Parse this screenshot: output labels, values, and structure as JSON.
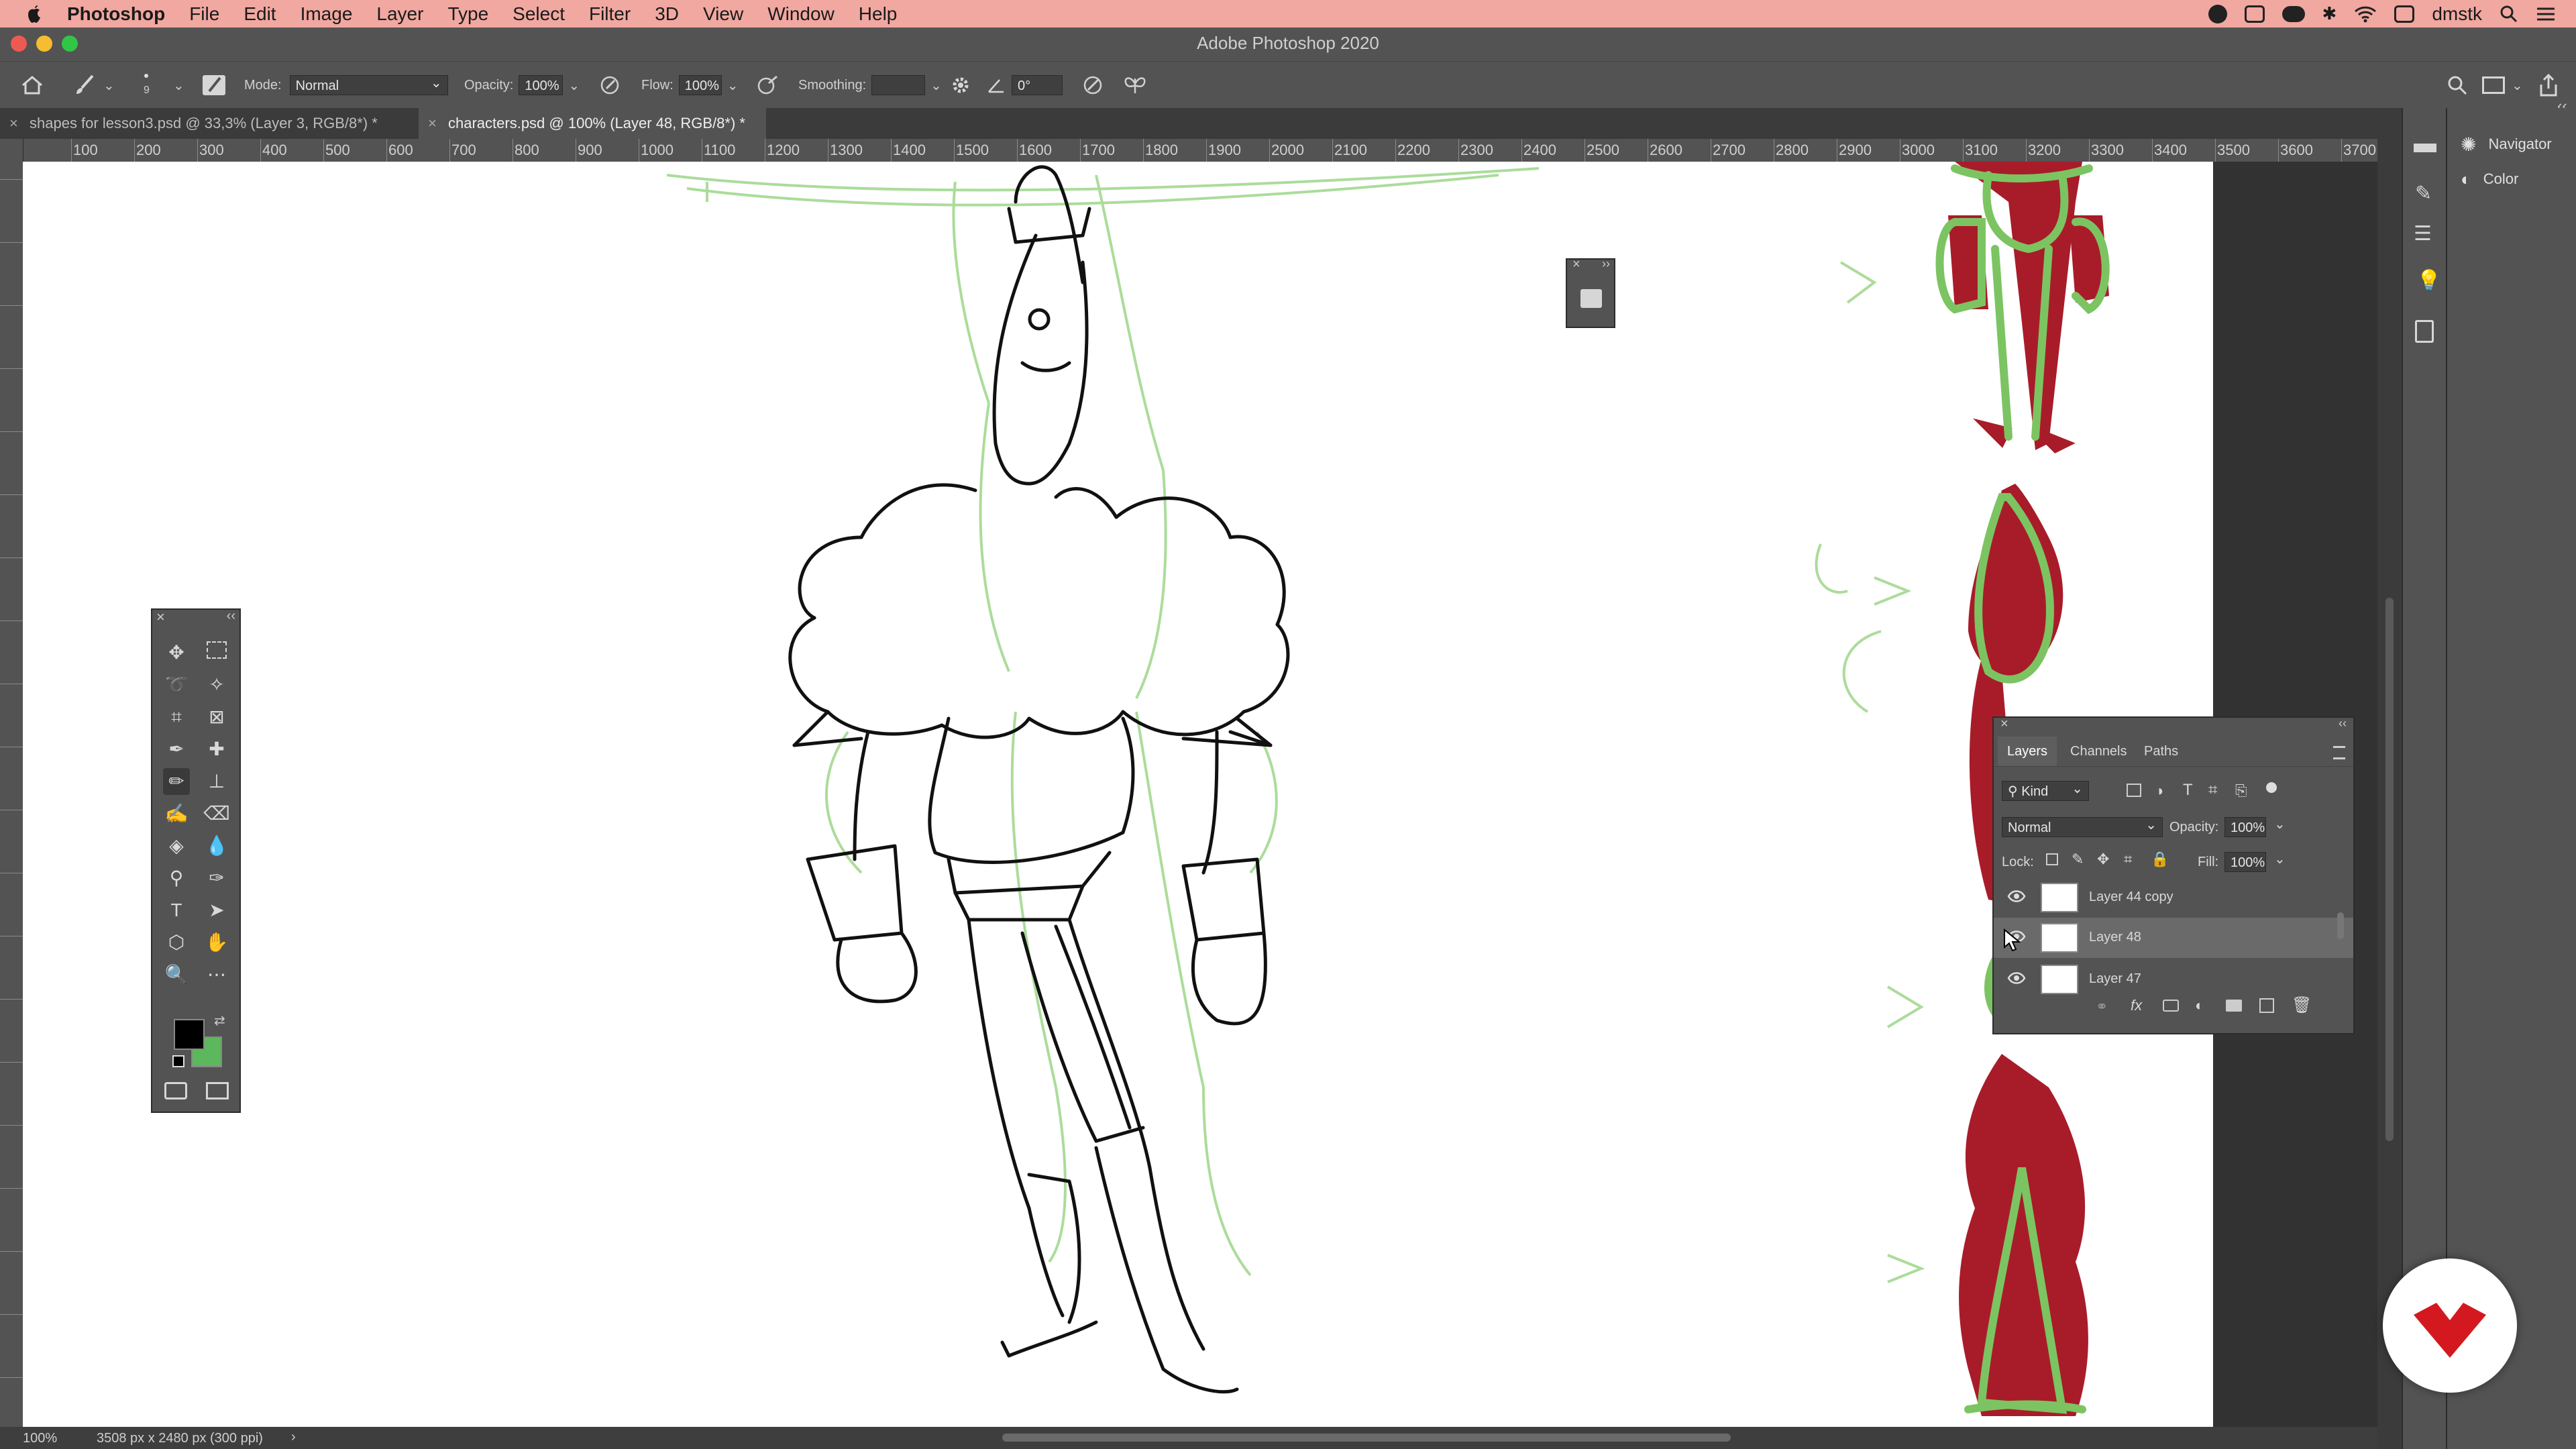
{
  "menubar": {
    "app_name": "Photoshop",
    "items": [
      "File",
      "Edit",
      "Image",
      "Layer",
      "Type",
      "Select",
      "Filter",
      "3D",
      "View",
      "Window",
      "Help"
    ],
    "user": "dmstk"
  },
  "window": {
    "title": "Adobe Photoshop 2020"
  },
  "options": {
    "brush_size": "9",
    "mode_label": "Mode:",
    "mode_value": "Normal",
    "opacity_label": "Opacity:",
    "opacity_value": "100%",
    "flow_label": "Flow:",
    "flow_value": "100%",
    "smoothing_label": "Smoothing:",
    "smoothing_value": "",
    "angle_value": "0°"
  },
  "tabs": [
    {
      "label": "shapes for lesson3.psd @ 33,3% (Layer 3, RGB/8*) *"
    },
    {
      "label": "characters.psd @ 100% (Layer 48, RGB/8*) *"
    }
  ],
  "ruler": {
    "h_ticks": [
      "100",
      "200",
      "300",
      "400",
      "500",
      "600",
      "700",
      "800",
      "900",
      "1000",
      "1100",
      "1200",
      "1300",
      "1400",
      "1500",
      "1600",
      "1700",
      "1800",
      "1900",
      "2000",
      "2100",
      "2200",
      "2300",
      "2400",
      "2500",
      "2600",
      "2700",
      "2800",
      "2900",
      "3000",
      "3100",
      "3200",
      "3300",
      "3400",
      "3500",
      "3600",
      "3700"
    ]
  },
  "dock": {
    "items": [
      {
        "label": "Navigator",
        "icon": "navigator-icon"
      },
      {
        "label": "Color",
        "icon": "color-icon"
      }
    ]
  },
  "layers_panel": {
    "tabs": [
      "Layers",
      "Channels",
      "Paths"
    ],
    "filter_kind": "Kind",
    "blend_mode": "Normal",
    "opacity_label": "Opacity:",
    "opacity_value": "100%",
    "lock_label": "Lock:",
    "fill_label": "Fill:",
    "fill_value": "100%",
    "layers": [
      {
        "name": "Layer 44 copy",
        "selected": false
      },
      {
        "name": "Layer 48",
        "selected": true
      },
      {
        "name": "Layer 47",
        "selected": false
      }
    ]
  },
  "status": {
    "zoom": "100%",
    "doc_info": "3508 px x 2480 px (300 ppi)"
  },
  "colors": {
    "foreground": "#000000",
    "background": "#5cb85c",
    "menubar": "#f0a8a0",
    "sketch_green": "#7cc462",
    "sketch_red": "#a81c2a"
  }
}
